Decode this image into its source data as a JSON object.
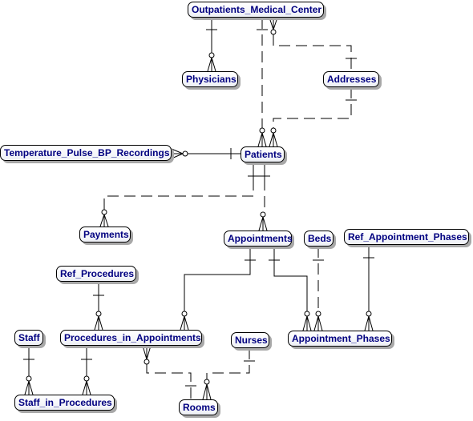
{
  "diagram": {
    "type": "entity-relationship",
    "entities": {
      "outpatients_medical_center": "Outpatients_Medical_Center",
      "physicians": "Physicians",
      "addresses": "Addresses",
      "temperature_pulse_bp_recordings": "Temperature_Pulse_BP_Recordings",
      "patients": "Patients",
      "payments": "Payments",
      "appointments": "Appointments",
      "beds": "Beds",
      "ref_appointment_phases": "Ref_Appointment_Phases",
      "ref_procedures": "Ref_Procedures",
      "staff": "Staff",
      "procedures_in_appointments": "Procedures_in_Appointments",
      "nurses": "Nurses",
      "appointment_phases": "Appointment_Phases",
      "staff_in_procedures": "Staff_in_Procedures",
      "rooms": "Rooms"
    },
    "relationships": [
      {
        "from": "Outpatients_Medical_Center",
        "to": "Physicians",
        "style": "solid",
        "from_card": "one",
        "to_card": "zero-or-many"
      },
      {
        "from": "Outpatients_Medical_Center",
        "to": "Patients",
        "style": "dashed",
        "from_card": "one",
        "to_card": "zero-or-many"
      },
      {
        "from": "Addresses",
        "to": "Outpatients_Medical_Center",
        "style": "dashed",
        "from_card": "one",
        "to_card": "zero-or-many"
      },
      {
        "from": "Addresses",
        "to": "Patients",
        "style": "dashed",
        "from_card": "one",
        "to_card": "zero-or-many"
      },
      {
        "from": "Patients",
        "to": "Temperature_Pulse_BP_Recordings",
        "style": "solid",
        "from_card": "one",
        "to_card": "zero-or-many"
      },
      {
        "from": "Patients",
        "to": "Payments",
        "style": "dashed",
        "from_card": "one",
        "to_card": "zero-or-many"
      },
      {
        "from": "Patients",
        "to": "Appointments",
        "style": "dashed",
        "from_card": "one",
        "to_card": "zero-or-many"
      },
      {
        "from": "Appointments",
        "to": "Procedures_in_Appointments",
        "style": "solid",
        "from_card": "one",
        "to_card": "zero-or-many"
      },
      {
        "from": "Appointments",
        "to": "Appointment_Phases",
        "style": "solid",
        "from_card": "one",
        "to_card": "zero-or-many"
      },
      {
        "from": "Beds",
        "to": "Appointment_Phases",
        "style": "dashed",
        "from_card": "one",
        "to_card": "zero-or-many"
      },
      {
        "from": "Ref_Appointment_Phases",
        "to": "Appointment_Phases",
        "style": "solid",
        "from_card": "one",
        "to_card": "zero-or-many"
      },
      {
        "from": "Ref_Procedures",
        "to": "Procedures_in_Appointments",
        "style": "solid",
        "from_card": "one",
        "to_card": "zero-or-many"
      },
      {
        "from": "Staff",
        "to": "Staff_in_Procedures",
        "style": "solid",
        "from_card": "one",
        "to_card": "zero-or-many"
      },
      {
        "from": "Procedures_in_Appointments",
        "to": "Staff_in_Procedures",
        "style": "solid",
        "from_card": "one",
        "to_card": "zero-or-many"
      },
      {
        "from": "Rooms",
        "to": "Procedures_in_Appointments",
        "style": "dashed",
        "from_card": "one",
        "to_card": "zero-or-many"
      },
      {
        "from": "Nurses",
        "to": "Rooms",
        "style": "dashed",
        "from_card": "one",
        "to_card": "zero-or-many"
      }
    ]
  }
}
